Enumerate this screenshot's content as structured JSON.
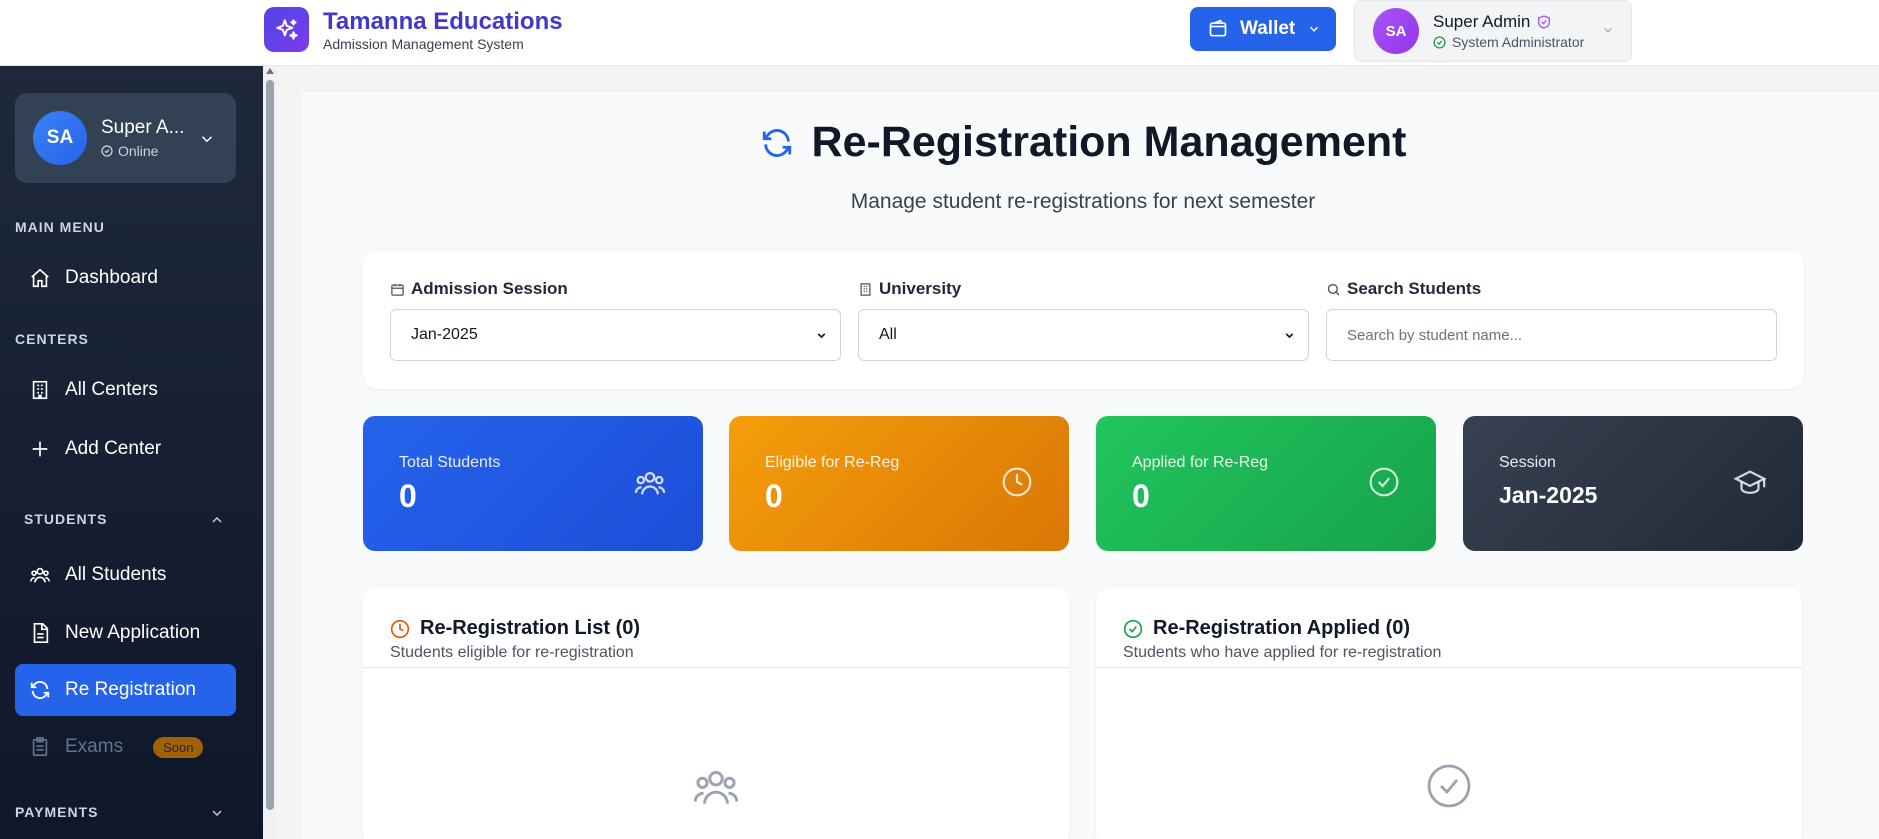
{
  "header": {
    "brand_title": "Tamanna Educations",
    "brand_subtitle": "Admission Management System",
    "wallet_label": "Wallet",
    "user_initials": "SA",
    "user_name": "Super Admin",
    "user_role": "System Administrator"
  },
  "sidebar": {
    "user_initials": "SA",
    "user_name": "Super A...",
    "user_status": "Online",
    "sections": {
      "main_menu": "MAIN MENU",
      "centers": "CENTERS",
      "students": "STUDENTS",
      "payments": "PAYMENTS"
    },
    "items": {
      "dashboard": "Dashboard",
      "all_centers": "All Centers",
      "add_center": "Add Center",
      "all_students": "All Students",
      "new_application": "New Application",
      "re_registration": "Re Registration",
      "exams": "Exams",
      "exams_badge": "Soon"
    }
  },
  "page": {
    "title": "Re-Registration Management",
    "subtitle": "Manage student re-registrations for next semester"
  },
  "filters": {
    "session_label": "Admission Session",
    "session_value": "Jan-2025",
    "university_label": "University",
    "university_value": "All",
    "search_label": "Search Students",
    "search_placeholder": "Search by student name..."
  },
  "stats": [
    {
      "label": "Total Students",
      "value": "0"
    },
    {
      "label": "Eligible for Re-Reg",
      "value": "0"
    },
    {
      "label": "Applied for Re-Reg",
      "value": "0"
    },
    {
      "label": "Session",
      "value": "Jan-2025"
    }
  ],
  "lists": {
    "eligible_title": "Re-Registration List (0)",
    "eligible_sub": "Students eligible for re-registration",
    "applied_title": "Re-Registration Applied (0)",
    "applied_sub": "Students who have applied for re-registration"
  },
  "colors": {
    "primary": "#2563eb",
    "brand": "#4338ca",
    "stat_blue": "#2563eb",
    "stat_orange": "#f59e0b",
    "stat_green": "#16a34a",
    "stat_dark": "#1f2937"
  }
}
